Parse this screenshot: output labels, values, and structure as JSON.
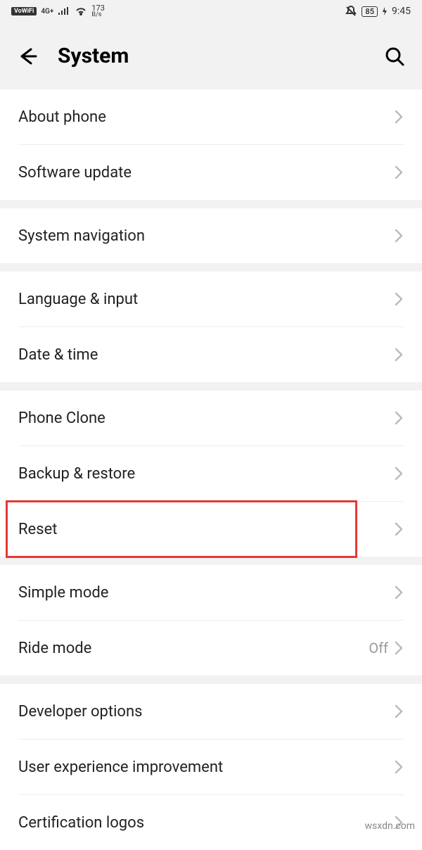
{
  "status": {
    "vowifi": "VoWiFi",
    "network": "4G+",
    "speed_num": "173",
    "speed_unit": "B/s",
    "battery": "85",
    "time": "9:45"
  },
  "header": {
    "title": "System"
  },
  "sections": [
    {
      "rows": [
        {
          "id": "about-phone",
          "label": "About phone"
        },
        {
          "id": "software-update",
          "label": "Software update"
        }
      ]
    },
    {
      "rows": [
        {
          "id": "system-navigation",
          "label": "System navigation"
        }
      ]
    },
    {
      "rows": [
        {
          "id": "language-input",
          "label": "Language & input"
        },
        {
          "id": "date-time",
          "label": "Date & time"
        }
      ]
    },
    {
      "rows": [
        {
          "id": "phone-clone",
          "label": "Phone Clone"
        },
        {
          "id": "backup-restore",
          "label": "Backup & restore"
        },
        {
          "id": "reset",
          "label": "Reset",
          "highlighted": true
        }
      ]
    },
    {
      "rows": [
        {
          "id": "simple-mode",
          "label": "Simple mode"
        },
        {
          "id": "ride-mode",
          "label": "Ride mode",
          "value": "Off"
        }
      ]
    },
    {
      "rows": [
        {
          "id": "developer-options",
          "label": "Developer options"
        },
        {
          "id": "user-experience-improvement",
          "label": "User experience improvement"
        },
        {
          "id": "certification-logos",
          "label": "Certification logos"
        }
      ]
    }
  ],
  "watermark": "wsxdn.com"
}
